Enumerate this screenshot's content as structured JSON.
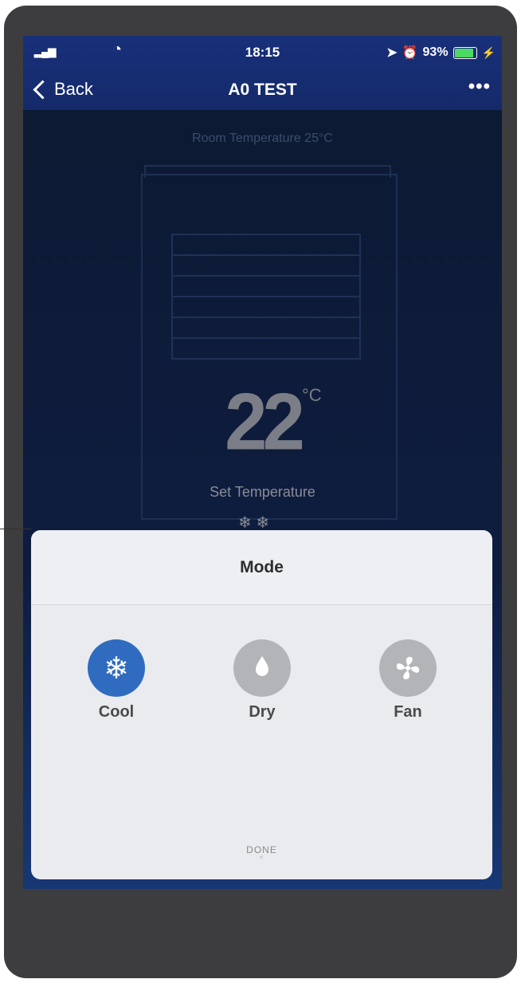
{
  "status_bar": {
    "signal": "▂▄▆",
    "wifi": "◔",
    "time": "18:15",
    "location": "➤",
    "alarm": "⏰",
    "battery_pct": "93%"
  },
  "nav": {
    "back_label": "Back",
    "title": "A0 TEST",
    "more": "•••"
  },
  "background": {
    "room_temperature": "Room Temperature 25°C",
    "set_temperature_value": "22",
    "set_temperature_unit": "°C",
    "set_temperature_label": "Set Temperature",
    "mode_icons": "❄ ❄"
  },
  "mode_sheet": {
    "title": "Mode",
    "options": [
      {
        "label": "Cool",
        "icon": "snowflake-icon",
        "glyph": "❄",
        "selected": true
      },
      {
        "label": "Dry",
        "icon": "droplets-icon",
        "glyph": "▲",
        "selected": false
      },
      {
        "label": "Fan",
        "icon": "fan-icon",
        "glyph": "✸",
        "selected": false
      }
    ],
    "done_label": "DONE",
    "done_chevron": "˅"
  },
  "colors": {
    "nav_bar": "#18307a",
    "selected_mode": "#2f6cc0",
    "unselected_mode": "#b3b4b7",
    "battery": "#4cd964"
  }
}
